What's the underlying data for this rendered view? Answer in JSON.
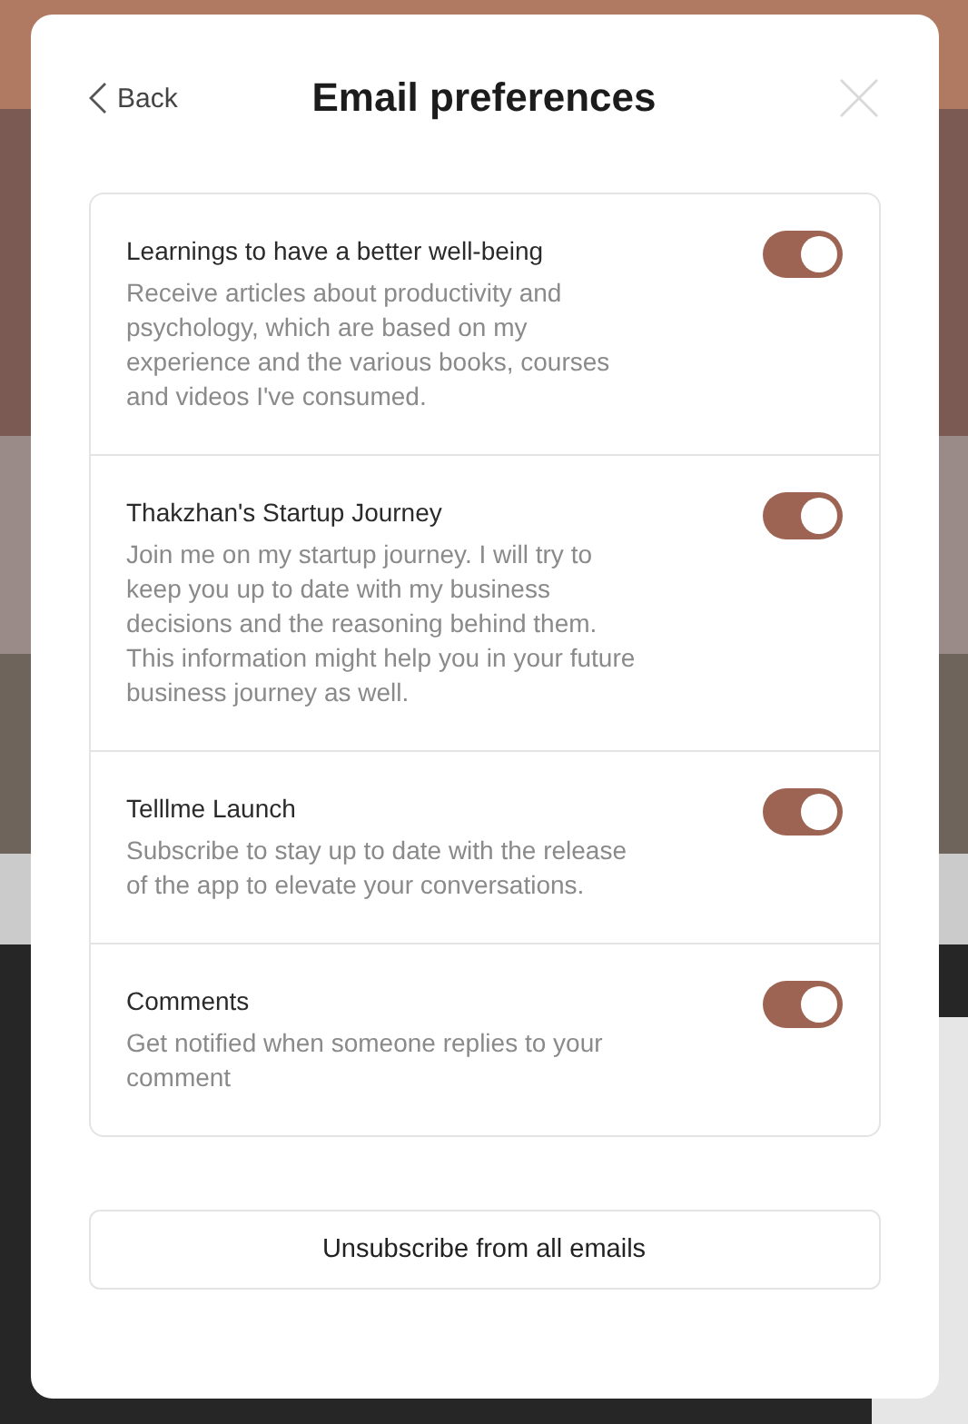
{
  "header": {
    "back": "Back",
    "title": "Email preferences"
  },
  "preferences": [
    {
      "title": "Learnings to have a better well-being",
      "description": "Receive articles about productivity and psychology, which are based on my experience and the various books, courses and videos I've consumed.",
      "on": true
    },
    {
      "title": "Thakzhan's Startup Journey",
      "description": "Join me on my startup journey. I will try to keep you up to date with my business decisions and the reasoning behind them. This information might help you in your future business journey as well.",
      "on": true
    },
    {
      "title": "Telllme Launch",
      "description": "Subscribe to stay up to date with the release of the app to elevate your conversations.",
      "on": true
    },
    {
      "title": "Comments",
      "description": "Get notified when someone replies to your comment",
      "on": true
    }
  ],
  "unsubscribe": "Unsubscribe from all emails"
}
